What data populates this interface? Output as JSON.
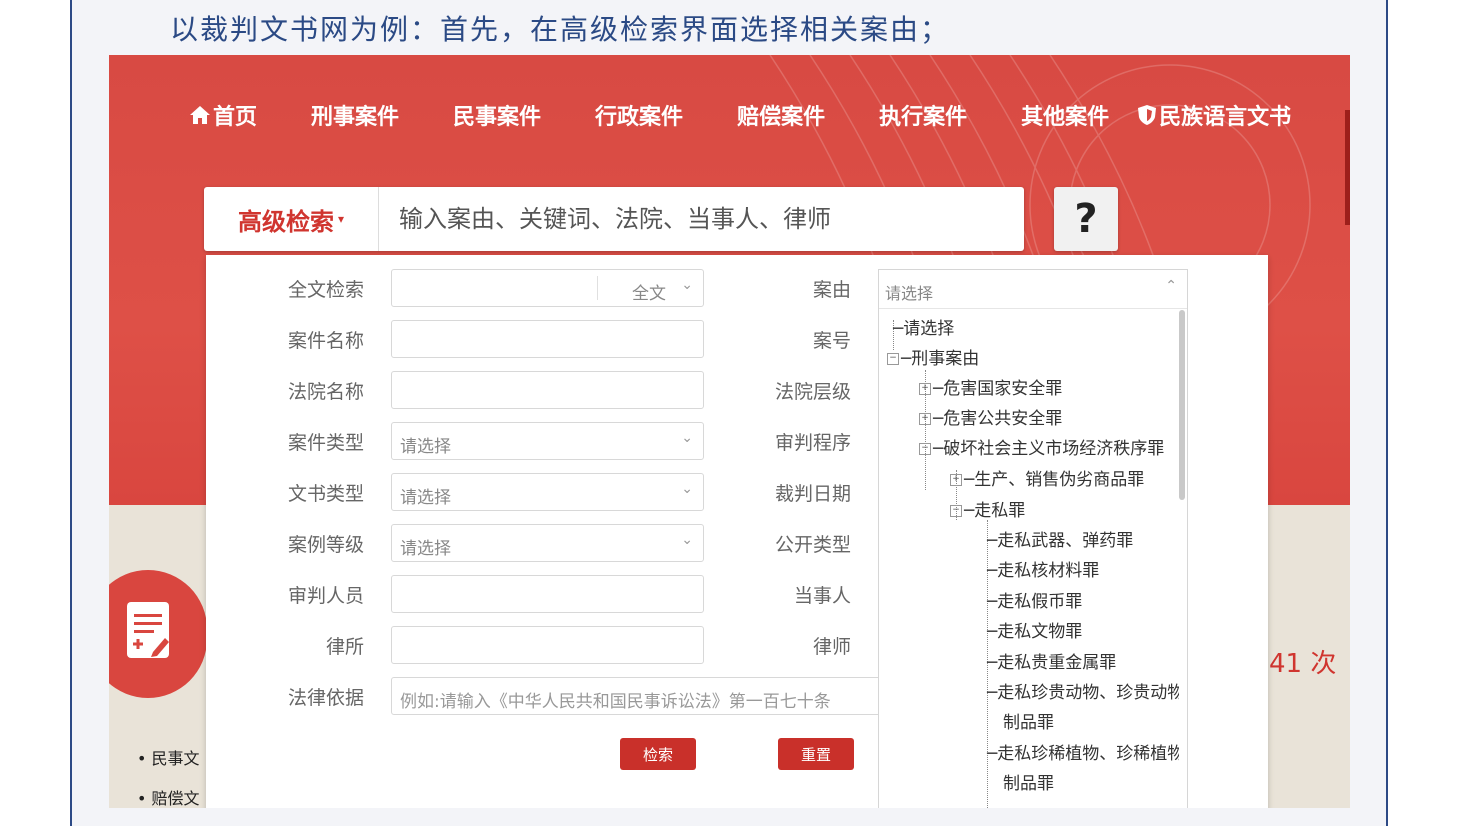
{
  "caption": "以裁判文书网为例：首先，在高级检索界面选择相关案由；",
  "nav": {
    "items": [
      {
        "id": "home",
        "label": "首页",
        "icon": "home-icon"
      },
      {
        "id": "criminal",
        "label": "刑事案件"
      },
      {
        "id": "civil",
        "label": "民事案件"
      },
      {
        "id": "admin",
        "label": "行政案件"
      },
      {
        "id": "compensation",
        "label": "赔偿案件"
      },
      {
        "id": "execution",
        "label": "执行案件"
      },
      {
        "id": "other",
        "label": "其他案件"
      },
      {
        "id": "ethnic",
        "label": "民族语言文书",
        "icon": "shield-icon"
      }
    ]
  },
  "search": {
    "advanced_label": "高级检索",
    "placeholder": "输入案由、关键词、法院、当事人、律师",
    "help_label": "?"
  },
  "form": {
    "left_fields": [
      {
        "label": "全文检索",
        "value": "",
        "scope": "全文"
      },
      {
        "label": "案件名称",
        "value": ""
      },
      {
        "label": "法院名称",
        "value": ""
      },
      {
        "label": "案件类型",
        "value": "请选择"
      },
      {
        "label": "文书类型",
        "value": "请选择"
      },
      {
        "label": "案例等级",
        "value": "请选择"
      },
      {
        "label": "审判人员",
        "value": ""
      },
      {
        "label": "律所",
        "value": ""
      },
      {
        "label": "法律依据",
        "placeholder": "例如:请输入《中华人民共和国民事诉讼法》第一百七十条"
      }
    ],
    "right_labels": [
      "案由",
      "案号",
      "法院层级",
      "审判程序",
      "裁判日期",
      "公开类型",
      "当事人",
      "律师"
    ],
    "cause_select": {
      "value": "请选择",
      "tree": [
        "请选择",
        "刑事案由",
        "危害国家安全罪",
        "危害公共安全罪",
        "破坏社会主义市场经济秩序罪",
        "生产、销售伪劣商品罪",
        "走私罪",
        "走私武器、弹药罪",
        "走私核材料罪",
        "走私假币罪",
        "走私文物罪",
        "走私贵重金属罪",
        "走私珍贵动物、珍贵动物",
        "制品罪",
        "走私珍稀植物、珍稀植物",
        "制品罪"
      ]
    },
    "search_button": "检索",
    "reset_button": "重置"
  },
  "background": {
    "side_links": [
      "民事文",
      "赔偿文"
    ],
    "counter_text": "41 次"
  },
  "colors": {
    "hero_red": "#d84a43",
    "accent_red": "#d0352f",
    "caption_blue": "#2b4a85"
  }
}
